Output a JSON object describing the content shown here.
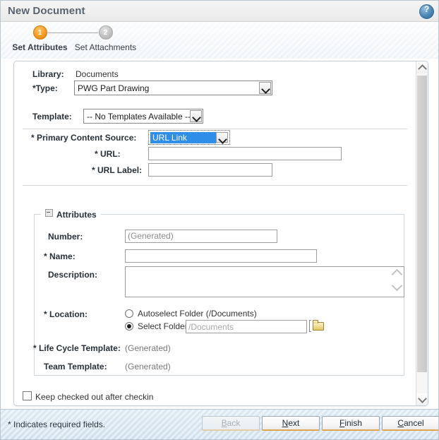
{
  "window": {
    "title": "New Document",
    "help_icon": "help-circle-icon"
  },
  "steps": [
    {
      "number": "1",
      "label": "Set Attributes",
      "state": "active"
    },
    {
      "number": "2",
      "label": "Set Attachments",
      "state": "inactive"
    }
  ],
  "form": {
    "library": {
      "label": "Library:",
      "value": "Documents"
    },
    "type": {
      "label": "*Type:",
      "value": "PWG Part Drawing",
      "required": true
    },
    "template": {
      "label": "Template:",
      "value": "-- No Templates Available --"
    },
    "primary_content_source": {
      "label": "* Primary Content Source:",
      "value": "URL Link",
      "focused": true
    },
    "url": {
      "label": "* URL:",
      "value": "",
      "placeholder": ""
    },
    "url_label": {
      "label": "* URL Label:",
      "value": "",
      "placeholder": ""
    }
  },
  "attributes": {
    "legend": "Attributes",
    "collapse_icon": "collapse-minus-icon",
    "number": {
      "label": "Number:",
      "value": "(Generated)"
    },
    "name": {
      "label": "* Name:",
      "value": "",
      "placeholder": ""
    },
    "description": {
      "label": "Description:",
      "value": "",
      "placeholder": ""
    },
    "location": {
      "label": "* Location:",
      "options": [
        {
          "label": "Autoselect Folder (/Documents)",
          "selected": false
        },
        {
          "label": "Select Folder",
          "selected": true
        }
      ],
      "folder_value": "",
      "folder_placeholder": "/Documents",
      "browse_icon": "folder-browse-icon"
    },
    "life_cycle_template": {
      "label": "* Life Cycle Template:",
      "value": "(Generated)"
    },
    "team_template": {
      "label": "Team Template:",
      "value": "(Generated)"
    }
  },
  "keep_checked_out": {
    "label": "Keep checked out after checkin",
    "checked": false
  },
  "footer": {
    "required_note": "* Indicates required fields.",
    "buttons": [
      {
        "name": "back",
        "pre": "",
        "mnemonic": "B",
        "post": "ack",
        "disabled": true
      },
      {
        "name": "next",
        "pre": "",
        "mnemonic": "N",
        "post": "ext",
        "disabled": false
      },
      {
        "name": "finish",
        "pre": "",
        "mnemonic": "F",
        "post": "inish",
        "disabled": false
      },
      {
        "name": "cancel",
        "pre": "",
        "mnemonic": "C",
        "post": "ancel",
        "disabled": false
      }
    ]
  },
  "colors": {
    "accent_orange": "#f59c22",
    "select_highlight": "#2f8fe8",
    "footer_bg": "#cfe0ec"
  }
}
